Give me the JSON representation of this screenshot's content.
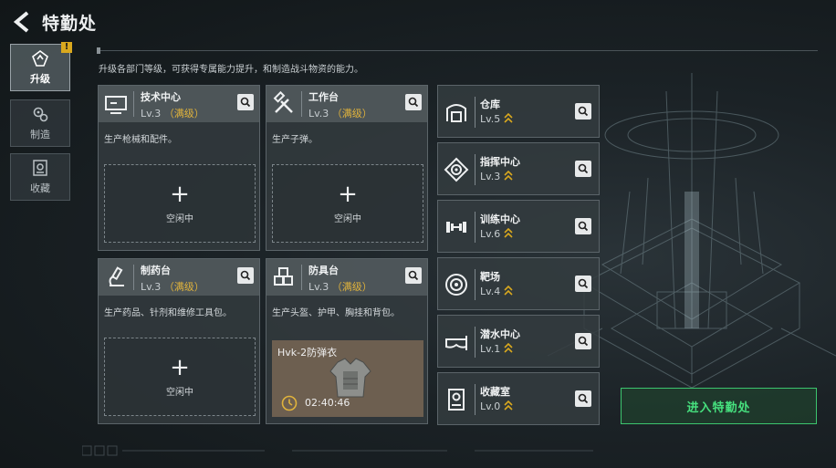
{
  "header": {
    "title": "特勤处"
  },
  "sidebar": {
    "tabs": [
      {
        "label": "升级",
        "active": true,
        "badge": "!"
      },
      {
        "label": "制造",
        "active": false
      },
      {
        "label": "收藏",
        "active": false
      }
    ]
  },
  "description": "升级各部门等级，可获得专属能力提升，和制造战斗物资的能力。",
  "departments": [
    {
      "name": "技术中心",
      "level": "Lv.3",
      "status": "（满级）",
      "desc": "生产枪械和配件。",
      "slot": {
        "plus": "+",
        "state": "空闲中"
      }
    },
    {
      "name": "工作台",
      "level": "Lv.3",
      "status": "（满级）",
      "desc": "生产子弹。",
      "slot": {
        "plus": "+",
        "state": "空闲中"
      }
    },
    {
      "name": "制药台",
      "level": "Lv.3",
      "status": "（满级）",
      "desc": "生产药品、针剂和维修工具包。",
      "slot": {
        "plus": "+",
        "state": "空闲中"
      }
    },
    {
      "name": "防具台",
      "level": "Lv.3",
      "status": "（满级）",
      "desc": "生产头盔、护甲、胸挂和背包。",
      "crafting": {
        "item": "Hvk-2防弹衣",
        "time": "02:40:46"
      }
    }
  ],
  "facilities": [
    {
      "name": "仓库",
      "level": "Lv.5",
      "icon": "warehouse-icon"
    },
    {
      "name": "指挥中心",
      "level": "Lv.3",
      "icon": "command-center-icon"
    },
    {
      "name": "训练中心",
      "level": "Lv.6",
      "icon": "dumbbell-icon"
    },
    {
      "name": "靶场",
      "level": "Lv.4",
      "icon": "target-icon"
    },
    {
      "name": "潜水中心",
      "level": "Lv.1",
      "icon": "diving-mask-icon"
    },
    {
      "name": "收藏室",
      "level": "Lv.0",
      "icon": "collection-room-icon"
    }
  ],
  "actions": {
    "enter_label": "进入特勤处"
  },
  "colors": {
    "accent_green": "#46e07e",
    "maxed_gold": "#e0b33c",
    "upgrade_gold": "#d9a81e"
  }
}
